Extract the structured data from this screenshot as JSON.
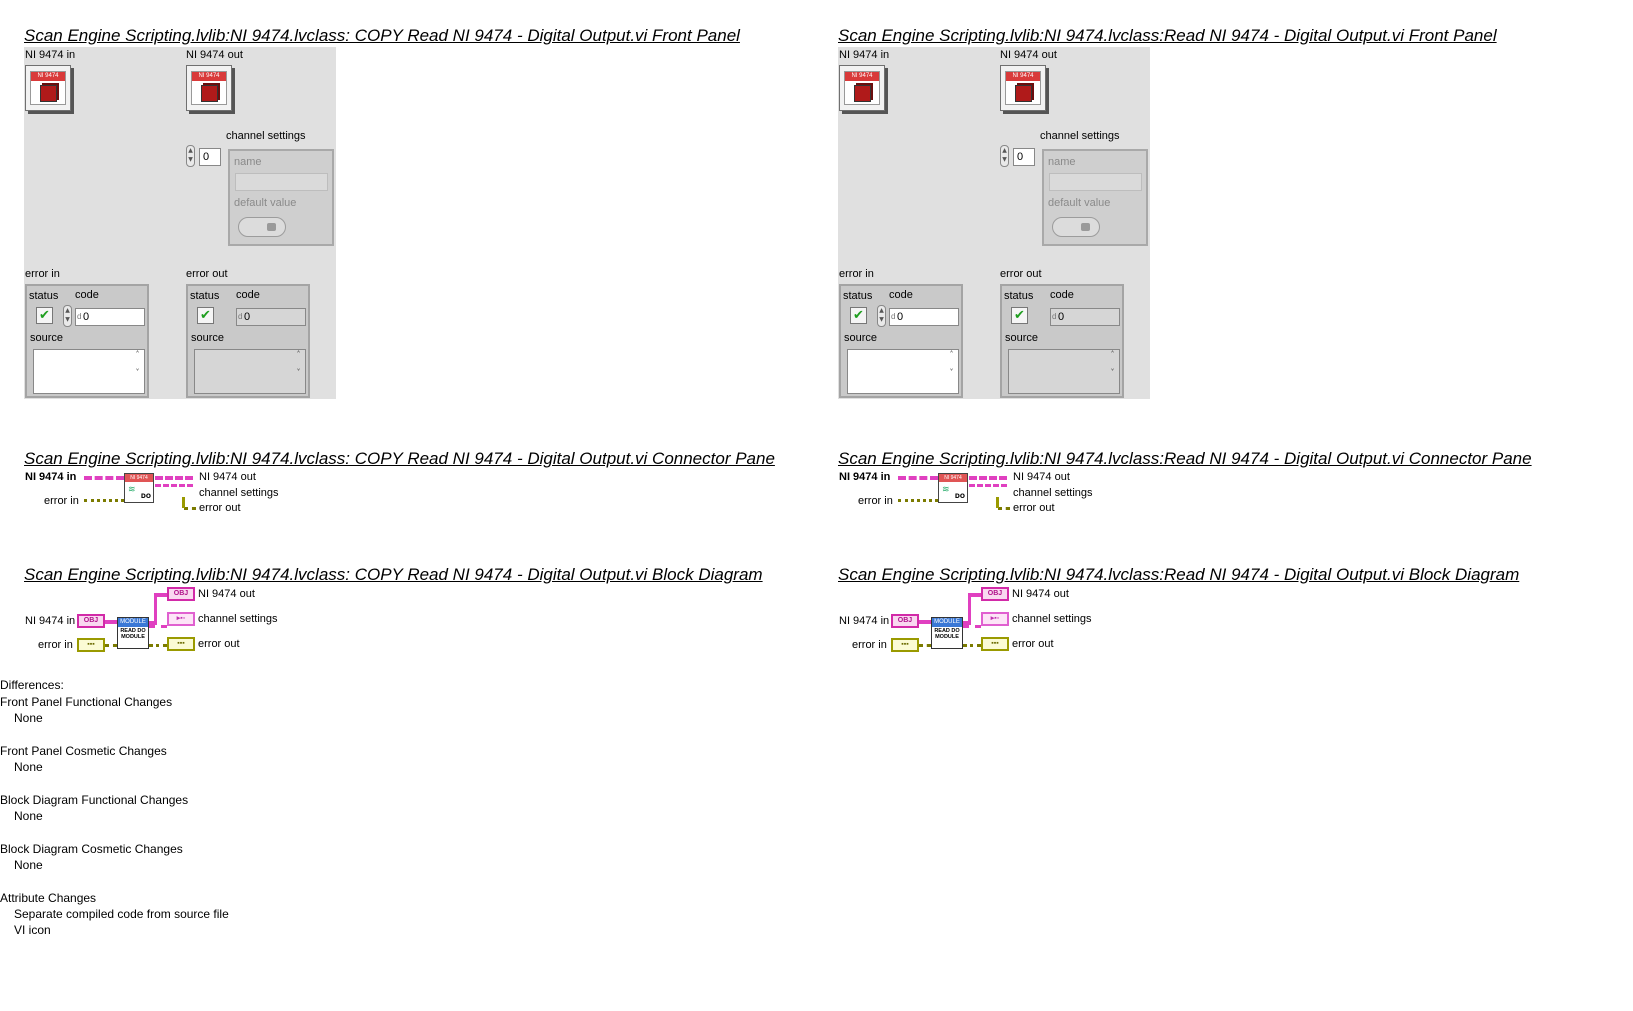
{
  "left": {
    "front_panel_title": "Scan Engine Scripting.lvlib:NI 9474.lvclass:  COPY  Read NI 9474 - Digital Output.vi Front Panel",
    "connector_pane_title": "Scan Engine Scripting.lvlib:NI 9474.lvclass:  COPY  Read NI 9474 - Digital Output.vi Connector Pane",
    "block_diagram_title": "Scan Engine Scripting.lvlib:NI 9474.lvclass:  COPY  Read NI 9474 - Digital Output.vi Block Diagram"
  },
  "right": {
    "front_panel_title": "Scan Engine Scripting.lvlib:NI 9474.lvclass:Read NI 9474 - Digital Output.vi Front Panel",
    "connector_pane_title": "Scan Engine Scripting.lvlib:NI 9474.lvclass:Read NI 9474 - Digital Output.vi Connector Pane",
    "block_diagram_title": "Scan Engine Scripting.lvlib:NI 9474.lvclass:Read NI 9474 - Digital Output.vi Block Diagram"
  },
  "front_panel": {
    "ni_in_label": "NI 9474 in",
    "ni_out_label": "NI 9474 out",
    "module_badge": "NI 9474",
    "channel_settings_label": "channel settings",
    "array_index_value": "0",
    "name_label": "name",
    "default_value_label": "default value",
    "error_in_label": "error in",
    "error_out_label": "error out",
    "status_label": "status",
    "code_label": "code",
    "code_value": "0",
    "source_label": "source",
    "code_radix": "d",
    "check_glyph": "✔"
  },
  "connector_pane": {
    "ni_in": "NI 9474 in",
    "error_in": "error in",
    "ni_out": "NI 9474 out",
    "channel_settings": "channel settings",
    "error_out": "error out",
    "vi_header": "NI 9474",
    "vi_subtext": "DO"
  },
  "block_diagram": {
    "ni_in": "NI 9474 in",
    "error_in": "error in",
    "ni_out": "NI 9474 out",
    "channel_settings": "channel settings",
    "error_out": "error out",
    "obj_terminal": "OBJ",
    "node_header": "MODULE",
    "node_text": "READ DO MODULE"
  },
  "differences": {
    "heading": "Differences:",
    "sections": [
      {
        "title": "Front Panel Functional Changes",
        "items": [
          "None"
        ]
      },
      {
        "title": "Front Panel Cosmetic Changes",
        "items": [
          "None"
        ]
      },
      {
        "title": "Block Diagram Functional Changes",
        "items": [
          "None"
        ]
      },
      {
        "title": "Block Diagram Cosmetic Changes",
        "items": [
          "None"
        ]
      },
      {
        "title": "Attribute Changes",
        "items": [
          "Separate compiled code from source file",
          "VI icon"
        ]
      }
    ]
  },
  "colors": {
    "panel_bg": "#e0e0e0",
    "class_wire": "#e040c0",
    "error_wire": "#9a9a00",
    "module_header": "#3a78d6",
    "ni_header": "#d93a3a"
  }
}
